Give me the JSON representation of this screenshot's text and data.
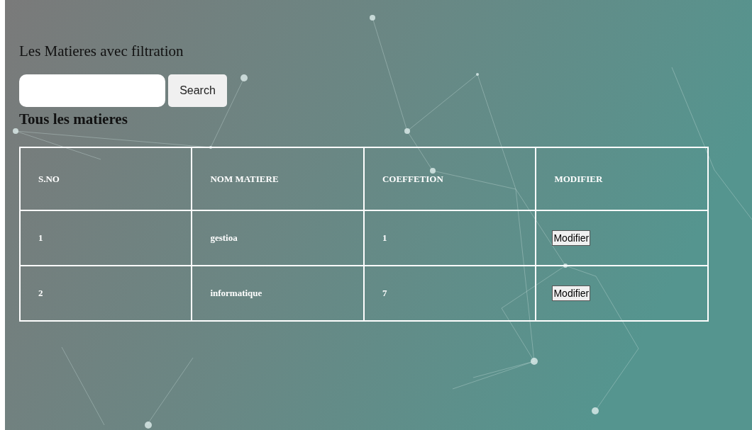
{
  "title": "Les Matieres avec filtration",
  "search": {
    "button": "Search"
  },
  "subtitle": "Tous les matieres",
  "table": {
    "columns": [
      "S.NO",
      "NOM MATIERE",
      "COEFFETION",
      "MODIFIER"
    ],
    "rows": [
      {
        "sno": "1",
        "nom": "gestioa",
        "coef": "1",
        "action": "Modifier"
      },
      {
        "sno": "2",
        "nom": "informatique",
        "coef": "7",
        "action": "Modifier"
      }
    ]
  }
}
